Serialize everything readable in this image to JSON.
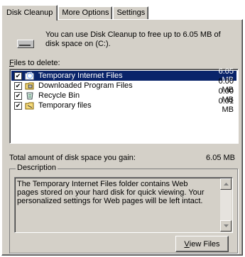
{
  "tabs": [
    {
      "label": "Disk Cleanup",
      "active": true
    },
    {
      "label": "More Options",
      "active": false
    },
    {
      "label": "Settings",
      "active": false
    }
  ],
  "intro_text": "You can use Disk Cleanup to free up to 6.05 MB of disk space on (C:).",
  "files_label_first": "F",
  "files_label_rest": "iles to delete:",
  "files": [
    {
      "name": "Temporary Internet Files",
      "size": "6.05 MB",
      "checked": true,
      "selected": true,
      "icon": "internet-files-icon"
    },
    {
      "name": "Downloaded Program Files",
      "size": "0.00 MB",
      "checked": true,
      "selected": false,
      "icon": "program-files-icon"
    },
    {
      "name": "Recycle Bin",
      "size": "0.00 MB",
      "checked": true,
      "selected": false,
      "icon": "recycle-bin-icon"
    },
    {
      "name": "Temporary files",
      "size": "0.01 MB",
      "checked": true,
      "selected": false,
      "icon": "temp-files-icon"
    }
  ],
  "total_label": "Total amount of disk space you gain:",
  "total_value": "6.05 MB",
  "description_title": "Description",
  "description_text": "The Temporary Internet Files folder contains Web pages stored on your hard disk for quick viewing. Your personalized settings for Web pages will be left intact.",
  "view_files_first": "V",
  "view_files_rest": "iew Files",
  "colors": {
    "face": "#d4d0c8",
    "selection": "#0a246a",
    "white": "#ffffff"
  }
}
